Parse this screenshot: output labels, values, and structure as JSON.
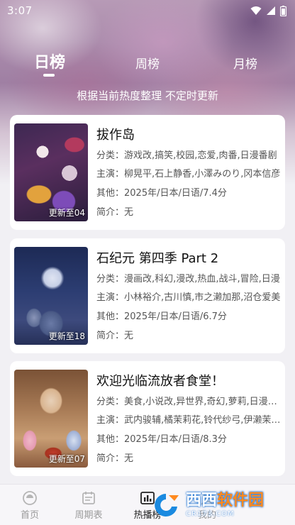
{
  "status_bar": {
    "time": "3:07"
  },
  "tabs": {
    "day": "日榜",
    "week": "周榜",
    "month": "月榜"
  },
  "subtitle": "根据当前热度整理 不定时更新",
  "labels": {
    "category": "分类：",
    "cast": "主演：",
    "other": "其他：",
    "intro": "简介："
  },
  "items": [
    {
      "title": "拔作岛",
      "category": "游戏改,搞笑,校园,恋爱,肉番,日漫番剧",
      "cast": "柳晃平,石上静香,小澤みのり,冈本信彦",
      "other": "2025年/日本/日语/7.4分",
      "intro": "无",
      "badge": "更新至04"
    },
    {
      "title": "石纪元 第四季 Part 2",
      "category": "漫画改,科幻,漫改,热血,战斗,冒险,日漫",
      "cast": "小林裕介,古川慎,市之濑加那,沼仓爱美",
      "other": "2025年/日本/日语/6.7分",
      "intro": "无",
      "badge": "更新至18"
    },
    {
      "title": "欢迎光临流放者食堂！",
      "category": "美食,小说改,异世界,奇幻,萝莉,日漫番剧",
      "cast": "武内骏辅,橘茉莉花,铃代纱弓,伊濑茉莉也",
      "other": "2025年/日本/日语/8.3分",
      "intro": "无",
      "badge": "更新至07"
    }
  ],
  "bottom_nav": {
    "home": "首页",
    "schedule": "周期表",
    "hot": "热播榜",
    "extra": "我的"
  },
  "watermark": {
    "main_part1": "西西",
    "main_part2": "软件园",
    "sub": "CR173.COM"
  }
}
